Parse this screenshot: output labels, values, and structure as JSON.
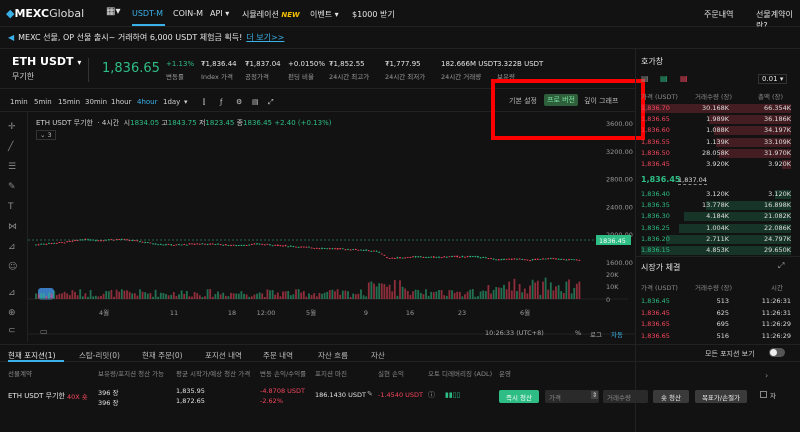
{
  "nav": {
    "logo_a": "MEXC",
    "logo_b": "Global",
    "usdtm": "USDT-M",
    "coinm": "COIN-M",
    "api": "API",
    "sim": "시뮬레이션",
    "new": "NEW",
    "event": "이벤트",
    "reward": "$1000 받기",
    "orders": "주문내역",
    "about": "선물계약이란?"
  },
  "announcement": {
    "text": "MEXC 선물, OP 선물 출시~ 거래하여 6,000 USDT 체험금 획득!",
    "link": "더 보기>>"
  },
  "ticker": {
    "symbol": "ETH USDT",
    "sub": "무기한",
    "price": "1,836.65",
    "change": "+1.13%",
    "change_label": "변동률",
    "index": "₮1,836.44",
    "index_label": "Index 가격",
    "fair": "₮1,837.04",
    "fair_label": "공정가격",
    "funding": "+0.0150%",
    "funding_label": "펀딩 비율",
    "high": "₮1,852.55",
    "high_label": "24시간 최고가",
    "low": "₮1,777.95",
    "low_label": "24시간 최저가",
    "vol": "182.666M",
    "vol_unit": "USDT",
    "vol_label": "24시간 거래량",
    "oi": "3.322B",
    "oi_unit": "USDT",
    "oi_label": "보유량"
  },
  "toolbar": {
    "tf": [
      "1min",
      "5min",
      "15min",
      "30min",
      "1hour",
      "4hour",
      "1day"
    ],
    "active_tf": "4hour",
    "view_basic": "기본 설정",
    "view_pro": "프로 버전",
    "view_depth": "깊이 그래프"
  },
  "legend": {
    "pair": "ETH USDT 무기한",
    "tf": "4시간",
    "o_label": "시",
    "o": "1834.05",
    "h_label": "고",
    "h": "1843.75",
    "l_label": "저",
    "l": "1823.45",
    "c_label": "종",
    "c": "1836.45",
    "chg": "+2.40 (+0.13%)",
    "count": "3"
  },
  "chart_data": {
    "type": "candlestick",
    "yaxis": [
      "3600.00",
      "3200.00",
      "2800.00",
      "2400.00",
      "2000.00",
      "1600.00"
    ],
    "last_price": "1836.45",
    "vol_axis": [
      "20K",
      "10K",
      "0"
    ],
    "xaxis": [
      "4월",
      "11",
      "18",
      "12:00",
      "5월",
      "9",
      "16",
      "23",
      "6월"
    ],
    "time": "10:26:33 (UTC+8)",
    "pct": "%",
    "log": "로그",
    "auto": "자동"
  },
  "orderbook": {
    "title": "호가창",
    "precision": "0.01",
    "col_price": "가격 (USDT)",
    "col_size": "거래수량 (장)",
    "col_total": "총액 (장)",
    "asks": [
      [
        "1,836.70",
        "30.168K",
        "66.354K"
      ],
      [
        "1,836.65",
        "1.989K",
        "36.186K"
      ],
      [
        "1,836.60",
        "1.088K",
        "34.197K"
      ],
      [
        "1,836.55",
        "1.139K",
        "33.109K"
      ],
      [
        "1,836.50",
        "28.058K",
        "31.970K"
      ],
      [
        "1,836.45",
        "3.920K",
        "3.920K"
      ]
    ],
    "mid": "1,836.45",
    "mid_sub": "1,837.04",
    "bids": [
      [
        "1,836.40",
        "3.120K",
        "3.120K"
      ],
      [
        "1,836.35",
        "13.778K",
        "16.898K"
      ],
      [
        "1,836.30",
        "4.184K",
        "21.082K"
      ],
      [
        "1,836.25",
        "1.004K",
        "22.086K"
      ],
      [
        "1,836.20",
        "2.711K",
        "24.797K"
      ],
      [
        "1,836.15",
        "4.853K",
        "29.650K"
      ]
    ]
  },
  "trades": {
    "title": "시장가 체결",
    "col_price": "가격 (USDT)",
    "col_size": "거래수량 (장)",
    "col_time": "시간",
    "rows": [
      [
        "1,836.45",
        "513",
        "11:26:31"
      ],
      [
        "1,836.45",
        "625",
        "11:26:31"
      ],
      [
        "1,836.65",
        "695",
        "11:26:29"
      ],
      [
        "1,836.65",
        "516",
        "11:26:29"
      ]
    ]
  },
  "tabs": {
    "items": [
      "현재 포지션(1)",
      "스탑-리밋(0)",
      "현재 주문(0)",
      "포지션 내역",
      "주문 내역",
      "자산 흐름",
      "자산"
    ],
    "show_all": "모든 포지션 보기"
  },
  "positions": {
    "headers": [
      "선물계약",
      "보유량/포지션 청산 가능",
      "평균 시작가/예상 청산 가격",
      "변동 손익/수익률",
      "포지션 마진",
      "실현 손익",
      "오토 디레버리징 (ADL)",
      "운영"
    ],
    "contract": "ETH USDT 무기한",
    "lev": "40X 숏",
    "qty1": "396 장",
    "qty2": "396 장",
    "avg": "1,835.95",
    "liq": "1,872.65",
    "pnl": "-4.8708 USDT",
    "roe": "-2.62%",
    "margin": "186.1430 USDT",
    "realized": "-1.4540 USDT",
    "close_btn": "즉시 청산",
    "price_ph": "가격",
    "size_ph": "거래수량",
    "close_short": "숏 청산",
    "tpsl": "목표가/손절가",
    "chk": "자"
  }
}
